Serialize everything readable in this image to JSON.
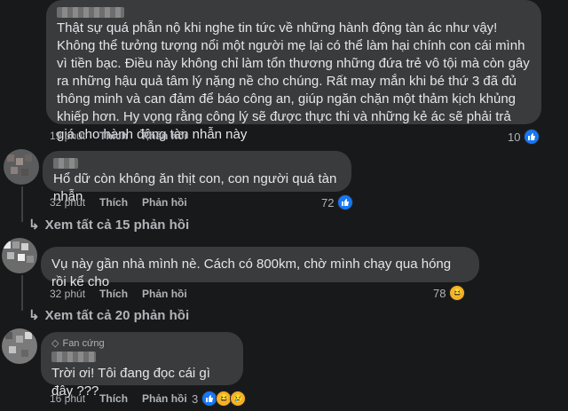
{
  "labels": {
    "like": "Thích",
    "reply": "Phản hồi"
  },
  "comments": [
    {
      "text": "Thật sự quá phẫn nộ khi nghe tin tức về những hành động tàn ác như vậy! Không thể tưởng tượng nổi một người mẹ lại có thể làm hại chính con cái mình vì tiền bạc. Điều này không chỉ làm tổn thương những đứa trẻ vô tội mà còn gây ra những hậu quả tâm lý nặng nề cho chúng. Rất may mắn khi bé thứ 3 đã đủ thông minh và can đảm để báo công an, giúp ngăn chặn một thảm kịch khủng khiếp hơn. Hy vọng rằng công lý sẽ được thực thi và những kẻ ác sẽ phải trả giá cho hành động tàn nhẫn này",
      "time": "19 phút",
      "reaction_count": "10",
      "reactions": [
        "like-icon"
      ]
    },
    {
      "text": "Hổ dữ còn không ăn thịt con, con người quá tàn nhẫn",
      "time": "32 phút",
      "reaction_count": "72",
      "reactions": [
        "like-icon"
      ],
      "view_replies": "Xem tất cả 15 phản hồi"
    },
    {
      "text": "Vụ này gần nhà mình nè. Cách có 800km, chờ mình chạy qua hóng rồi kể cho",
      "time": "32 phút",
      "reaction_count": "78",
      "reactions": [
        "haha-icon"
      ],
      "view_replies": "Xem tất cả 20 phản hồi"
    },
    {
      "badge": "Fan cứng",
      "text": "Trời ơi! Tôi đang đọc cái gì đây ???",
      "time": "16 phút",
      "reaction_count": "3",
      "reactions": [
        "like-icon",
        "haha-icon",
        "sad-icon"
      ]
    }
  ],
  "colors": {
    "background": "#18191a",
    "bubble": "#3a3b3c",
    "muted": "#b0b3b8",
    "like": "#1877f2"
  }
}
